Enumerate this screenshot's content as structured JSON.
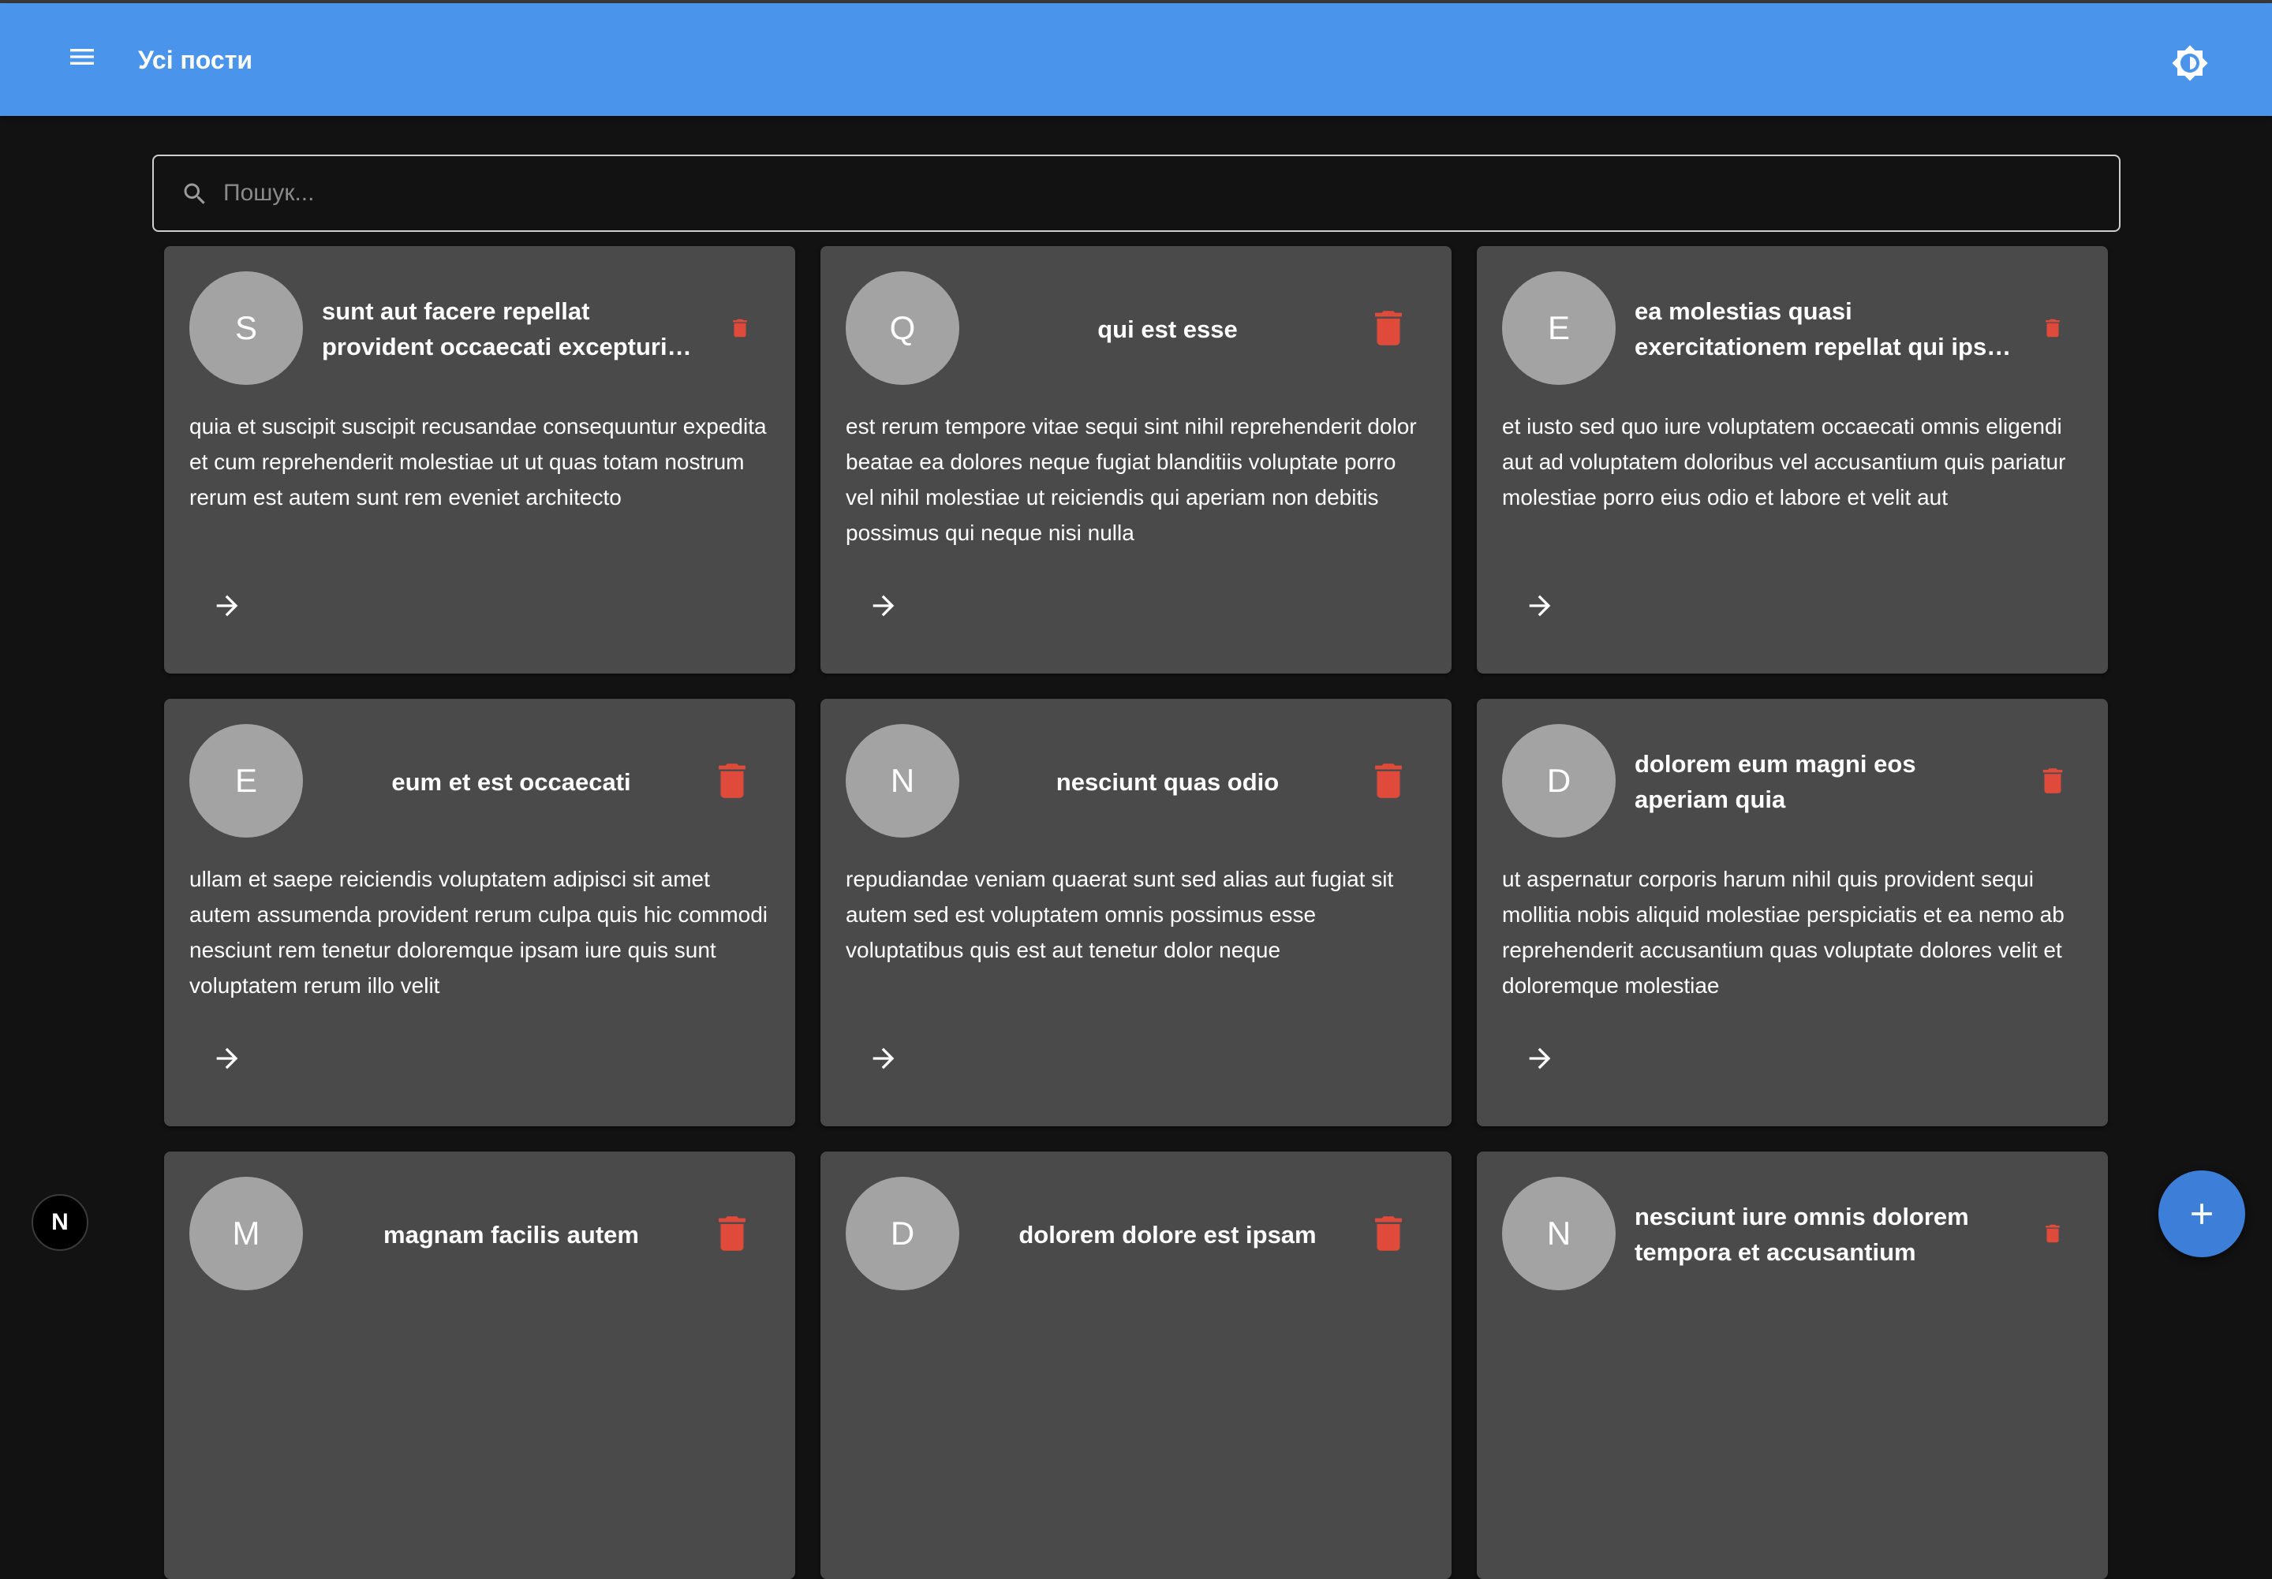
{
  "appbar": {
    "title": "Усі пости",
    "menu_icon": "menu-icon",
    "theme_icon": "brightness-icon",
    "color": "#4a94eb"
  },
  "search": {
    "placeholder": "Пошук...",
    "value": ""
  },
  "posts": [
    {
      "avatar": "S",
      "title": "sunt aut facere repellat provident occaecati excepturi optio reprehenderit",
      "body": "quia et suscipit suscipit recusandae consequuntur expedita et cum reprehenderit molestiae ut ut quas totam nostrum rerum est autem sunt rem eveniet architecto"
    },
    {
      "avatar": "Q",
      "title": "qui est esse",
      "body": "est rerum tempore vitae sequi sint nihil reprehenderit dolor beatae ea dolores neque fugiat blanditiis voluptate porro vel nihil molestiae ut reiciendis qui aperiam non debitis possimus qui neque nisi nulla"
    },
    {
      "avatar": "E",
      "title": "ea molestias quasi exercitationem repellat qui ipsa sit aut",
      "body": "et iusto sed quo iure voluptatem occaecati omnis eligendi aut ad voluptatem doloribus vel accusantium quis pariatur molestiae porro eius odio et labore et velit aut"
    },
    {
      "avatar": "E",
      "title": "eum et est occaecati",
      "body": "ullam et saepe reiciendis voluptatem adipisci sit amet autem assumenda provident rerum culpa quis hic commodi nesciunt rem tenetur doloremque ipsam iure quis sunt voluptatem rerum illo velit"
    },
    {
      "avatar": "N",
      "title": "nesciunt quas odio",
      "body": "repudiandae veniam quaerat sunt sed alias aut fugiat sit autem sed est voluptatem omnis possimus esse voluptatibus quis est aut tenetur dolor neque"
    },
    {
      "avatar": "D",
      "title": "dolorem eum magni eos aperiam quia",
      "body": "ut aspernatur corporis harum nihil quis provident sequi mollitia nobis aliquid molestiae perspiciatis et ea nemo ab reprehenderit accusantium quas voluptate dolores velit et doloremque molestiae"
    },
    {
      "avatar": "M",
      "title": "magnam facilis autem",
      "body": ""
    },
    {
      "avatar": "D",
      "title": "dolorem dolore est ipsam",
      "body": ""
    },
    {
      "avatar": "N",
      "title": "nesciunt iure omnis dolorem tempora et accusantium",
      "body": ""
    }
  ],
  "delete_color": "#e04a3b",
  "fab_icon": "plus-icon",
  "next_badge_label": "N"
}
